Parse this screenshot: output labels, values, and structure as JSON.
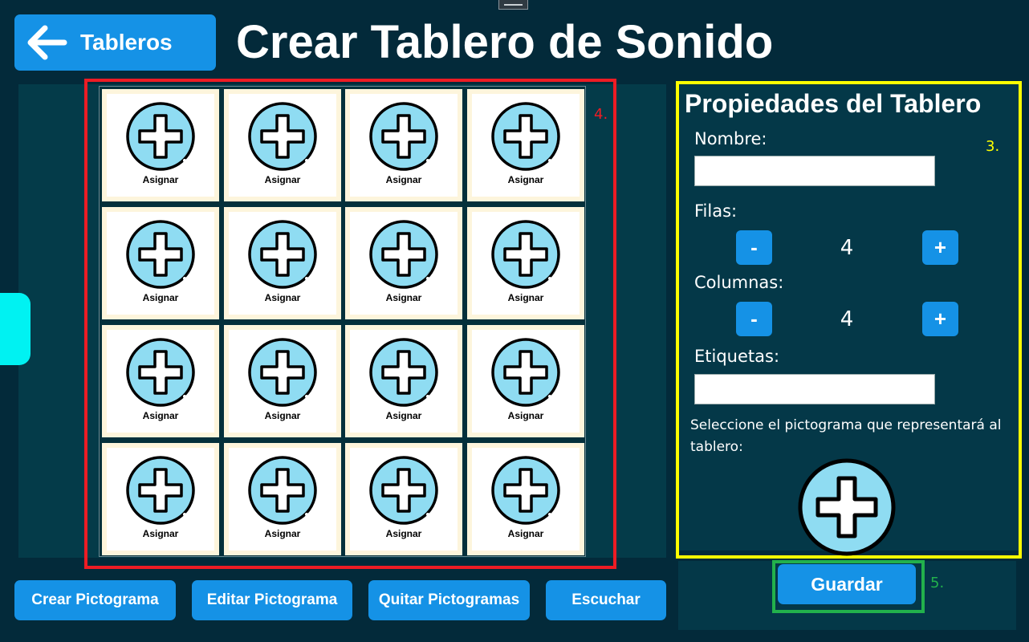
{
  "header": {
    "back_label": "Tableros",
    "title": "Crear Tablero de Sonido"
  },
  "board": {
    "annotation": "4.",
    "rows": 4,
    "columns": 4,
    "cells": [
      {
        "label": "Asignar"
      },
      {
        "label": "Asignar"
      },
      {
        "label": "Asignar"
      },
      {
        "label": "Asignar"
      },
      {
        "label": "Asignar"
      },
      {
        "label": "Asignar"
      },
      {
        "label": "Asignar"
      },
      {
        "label": "Asignar"
      },
      {
        "label": "Asignar"
      },
      {
        "label": "Asignar"
      },
      {
        "label": "Asignar"
      },
      {
        "label": "Asignar"
      },
      {
        "label": "Asignar"
      },
      {
        "label": "Asignar"
      },
      {
        "label": "Asignar"
      },
      {
        "label": "Asignar"
      }
    ],
    "cell_icon": "add-plus-icon"
  },
  "properties": {
    "title": "Propiedades del Tablero",
    "annotation": "3.",
    "name_label": "Nombre:",
    "name_value": "",
    "rows_label": "Filas:",
    "rows_value": "4",
    "columns_label": "Columnas:",
    "columns_value": "4",
    "minus_label": "-",
    "plus_label": "+",
    "tags_label": "Etiquetas:",
    "tags_value": "",
    "pictogram_hint": "Seleccione el pictograma que representará al tablero:",
    "pictogram_icon": "add-plus-icon"
  },
  "save": {
    "label": "Guardar",
    "annotation": "5."
  },
  "bottom_buttons": {
    "create": "Crear Pictograma",
    "edit": "Editar Pictograma",
    "remove": "Quitar Pictogramas",
    "listen": "Escuchar"
  },
  "colors": {
    "background": "#032a3a",
    "panel": "#043848",
    "accent": "#1592e6",
    "annotation_red": "#ee1c24",
    "annotation_yellow": "#ffff00",
    "annotation_green": "#22b14c",
    "side_tab": "#00f2f2",
    "icon_fill": "#8fdcf2"
  }
}
